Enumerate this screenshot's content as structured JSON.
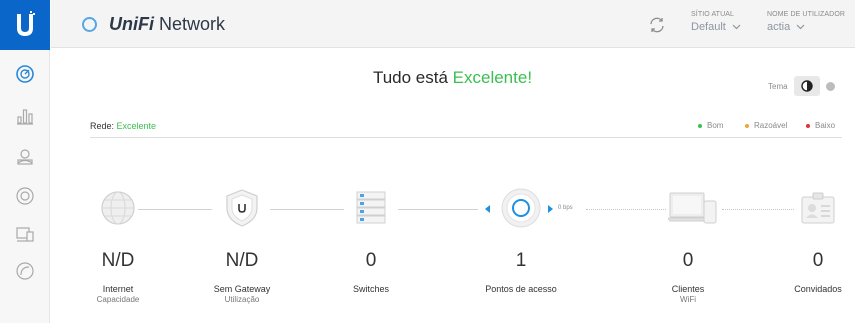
{
  "app": {
    "brand_unifi": "UniFi",
    "brand_network": "Network"
  },
  "header": {
    "site_label": "SÍTIO ATUAL",
    "site_value": "Default",
    "user_label": "NOME DE UTILIZADOR",
    "user_value": "actia"
  },
  "status": {
    "prefix": "Tudo está ",
    "highlight": "Excelente!"
  },
  "theme": {
    "label": "Tema"
  },
  "network": {
    "label": "Rede: ",
    "value": "Excelente",
    "legend": [
      {
        "label": "Bom",
        "color": "#3bbf51"
      },
      {
        "label": "Razoável",
        "color": "#f0a33a"
      },
      {
        "label": "Baixo",
        "color": "#e0303a"
      }
    ]
  },
  "throughput": "0 bps",
  "stats": [
    {
      "value": "N/D",
      "label": "Internet",
      "sub": "Capacidade"
    },
    {
      "value": "N/D",
      "label": "Sem Gateway",
      "sub": "Utilização"
    },
    {
      "value": "0",
      "label": "Switches",
      "sub": ""
    },
    {
      "value": "1",
      "label": "Pontos de acesso",
      "sub": ""
    },
    {
      "value": "0",
      "label": "Clientes",
      "sub": "WiFi"
    },
    {
      "value": "0",
      "label": "Convidados",
      "sub": ""
    }
  ],
  "colors": {
    "accent": "#0a66c8",
    "good": "#3bbf51",
    "ap_ring": "#1f8fe0"
  },
  "icons": {
    "sidebar": [
      "dashboard-icon",
      "statistics-icon",
      "map-icon",
      "devices-icon",
      "clients-icon",
      "insights-icon"
    ],
    "nodes": [
      "globe-icon",
      "gateway-shield-icon",
      "switch-stack-icon",
      "access-point-icon",
      "client-devices-icon",
      "guest-badge-icon"
    ]
  }
}
